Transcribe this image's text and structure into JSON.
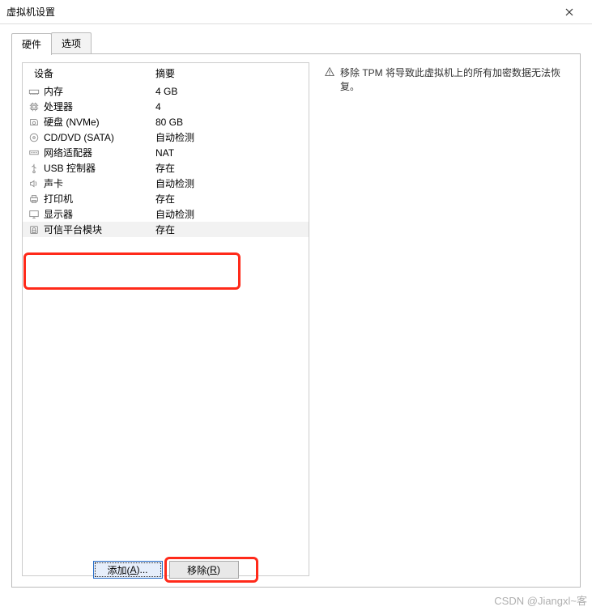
{
  "window": {
    "title": "虚拟机设置"
  },
  "tabs": {
    "hardware": "硬件",
    "options": "选项"
  },
  "hwHeader": {
    "device": "设备",
    "summary": "摘要"
  },
  "hwList": [
    {
      "icon": "memory-icon",
      "name": "内存",
      "summary": "4 GB",
      "selected": false
    },
    {
      "icon": "cpu-icon",
      "name": "处理器",
      "summary": "4",
      "selected": false
    },
    {
      "icon": "disk-icon",
      "name": "硬盘 (NVMe)",
      "summary": "80 GB",
      "selected": false
    },
    {
      "icon": "cd-icon",
      "name": "CD/DVD (SATA)",
      "summary": "自动检测",
      "selected": false
    },
    {
      "icon": "network-icon",
      "name": "网络适配器",
      "summary": "NAT",
      "selected": false
    },
    {
      "icon": "usb-icon",
      "name": "USB 控制器",
      "summary": "存在",
      "selected": false
    },
    {
      "icon": "sound-icon",
      "name": "声卡",
      "summary": "自动检测",
      "selected": false
    },
    {
      "icon": "printer-icon",
      "name": "打印机",
      "summary": "存在",
      "selected": false
    },
    {
      "icon": "display-icon",
      "name": "显示器",
      "summary": "自动检测",
      "selected": false
    },
    {
      "icon": "tpm-icon",
      "name": "可信平台模块",
      "summary": "存在",
      "selected": true
    }
  ],
  "info": {
    "warning": "移除 TPM 将导致此虚拟机上的所有加密数据无法恢复。"
  },
  "buttons": {
    "add_pre": "添加(",
    "add_u": "A",
    "add_post": ")...",
    "remove_pre": "移除(",
    "remove_u": "R",
    "remove_post": ")"
  },
  "watermark": "CSDN @Jiangxl~客"
}
